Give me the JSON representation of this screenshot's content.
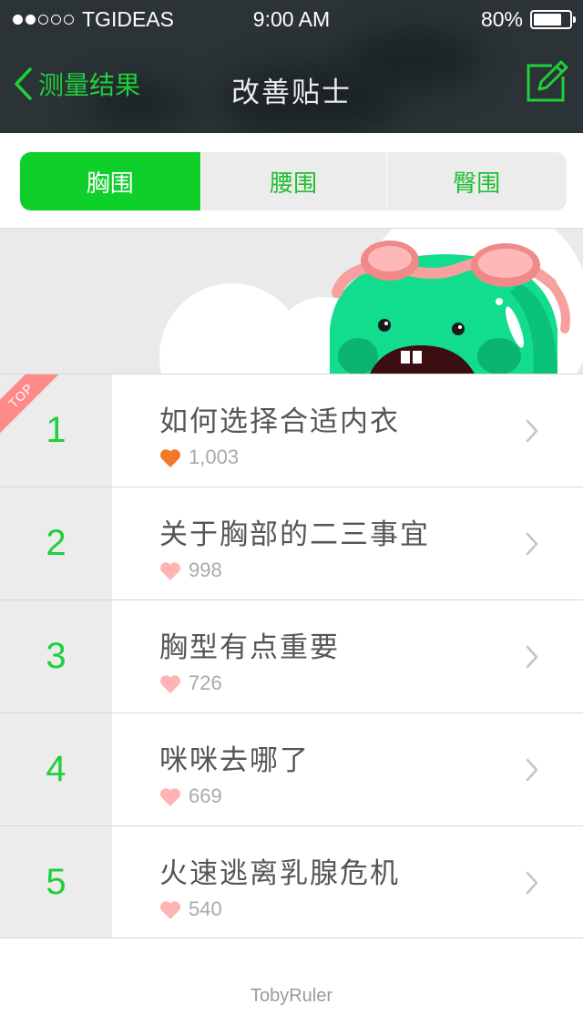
{
  "status_bar": {
    "carrier": "TGIDEAS",
    "time": "9:00 AM",
    "battery": "80%",
    "battery_level": 0.8
  },
  "header": {
    "back_label": "测量结果",
    "title": "改善贴士"
  },
  "segments": [
    {
      "label": "胸围",
      "active": true
    },
    {
      "label": "腰围",
      "active": false
    },
    {
      "label": "臀围",
      "active": false
    }
  ],
  "list": {
    "top_badge": "TOP",
    "items": [
      {
        "rank": "1",
        "title": "如何选择合适内衣",
        "likes": "1,003"
      },
      {
        "rank": "2",
        "title": "关于胸部的二三事宜",
        "likes": "998"
      },
      {
        "rank": "3",
        "title": "胸型有点重要",
        "likes": "726"
      },
      {
        "rank": "4",
        "title": "咪咪去哪了",
        "likes": "669"
      },
      {
        "rank": "5",
        "title": "火速逃离乳腺危机",
        "likes": "540"
      }
    ]
  },
  "footer": {
    "credit": "TobyRuler"
  },
  "colors": {
    "accent": "#0fcf2a",
    "header_bg": "#2b3336",
    "heart_hot": "#f07a2a",
    "heart": "#ffb3b3",
    "ribbon": "#ff8a8a"
  }
}
